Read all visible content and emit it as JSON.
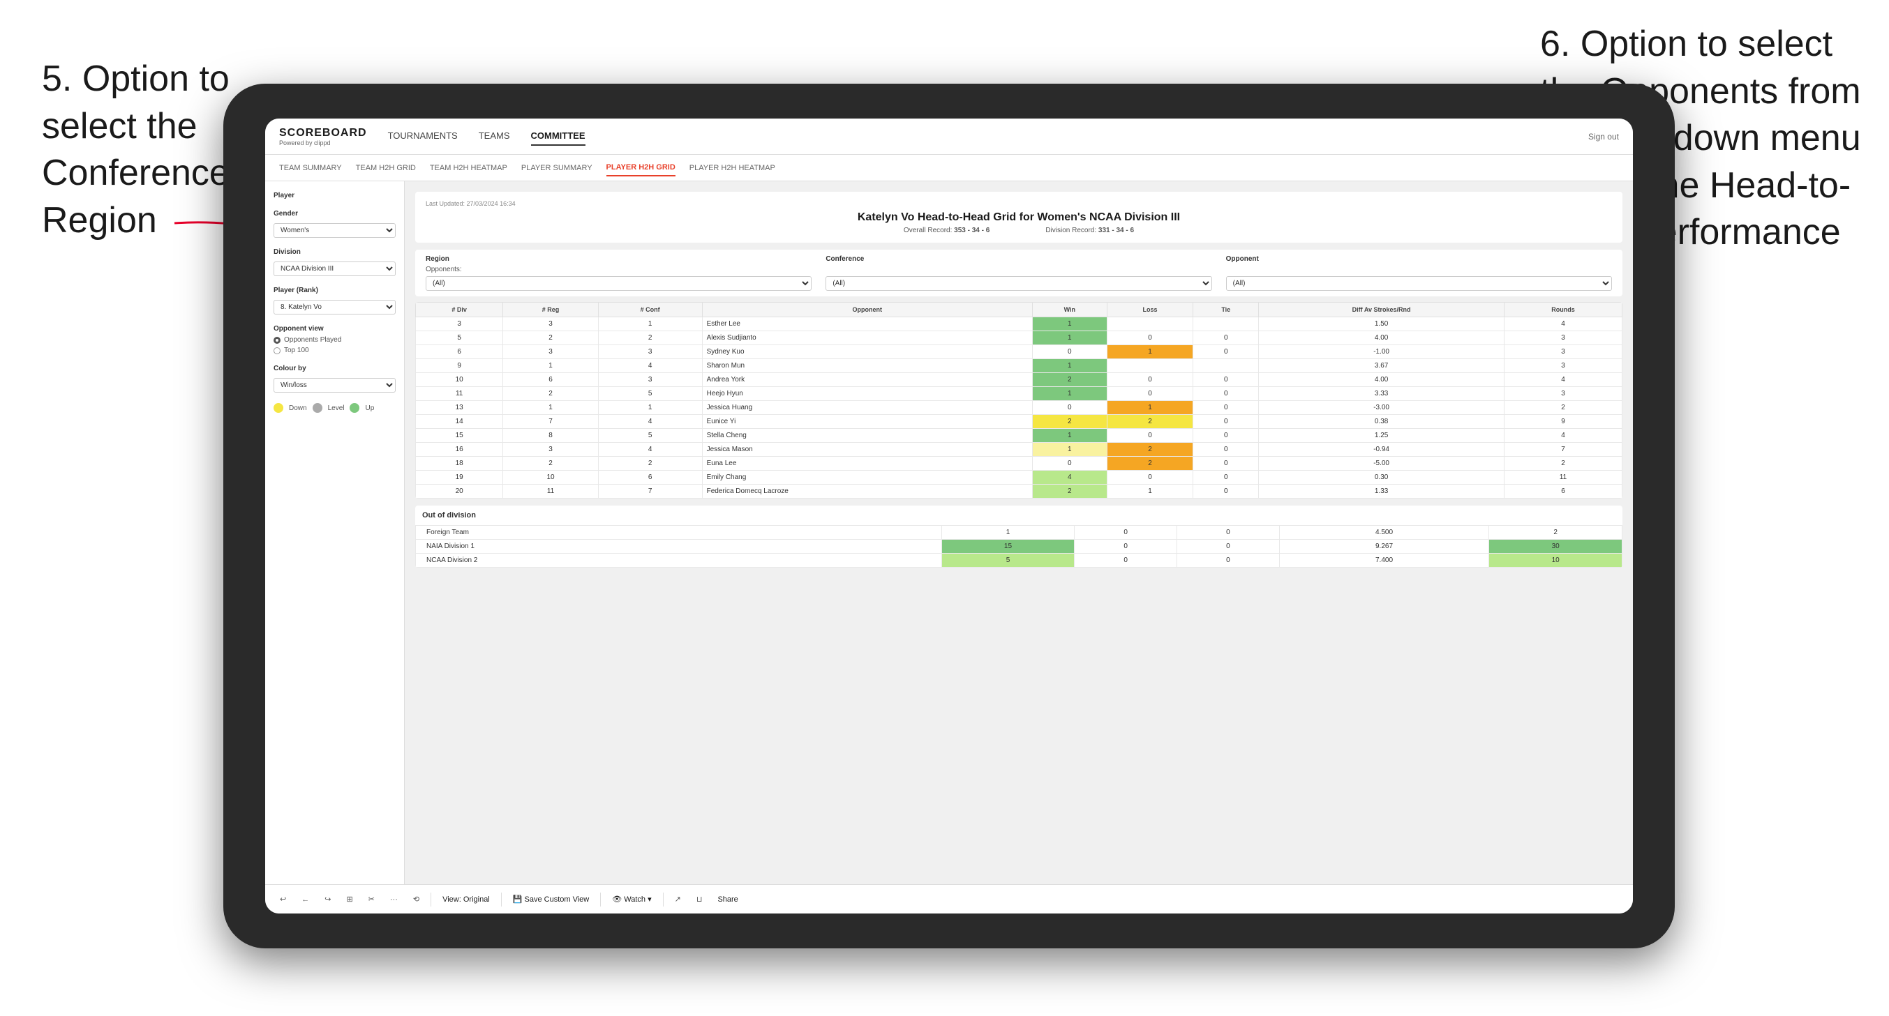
{
  "annotations": {
    "left": {
      "text": "5. Option to select the Conference and Region"
    },
    "right": {
      "text": "6. Option to select the Opponents from the dropdown menu to see the Head-to-Head performance"
    }
  },
  "nav": {
    "logo": "SCOREBOARD",
    "logo_sub": "Powered by clippd",
    "items": [
      "TOURNAMENTS",
      "TEAMS",
      "COMMITTEE"
    ],
    "active": "COMMITTEE",
    "sign_out": "Sign out"
  },
  "sub_nav": {
    "items": [
      "TEAM SUMMARY",
      "TEAM H2H GRID",
      "TEAM H2H HEATMAP",
      "PLAYER SUMMARY",
      "PLAYER H2H GRID",
      "PLAYER H2H HEATMAP"
    ],
    "active": "PLAYER H2H GRID"
  },
  "left_panel": {
    "player_label": "Player",
    "gender_label": "Gender",
    "gender_value": "Women's",
    "division_label": "Division",
    "division_value": "NCAA Division III",
    "player_rank_label": "Player (Rank)",
    "player_rank_value": "8. Katelyn Vo",
    "opponent_view_label": "Opponent view",
    "opponent_view_options": [
      "Opponents Played",
      "Top 100"
    ],
    "opponent_view_selected": "Opponents Played",
    "colour_by_label": "Colour by",
    "colour_by_value": "Win/loss",
    "legend": {
      "down_label": "Down",
      "level_label": "Level",
      "up_label": "Up"
    }
  },
  "content": {
    "last_updated": "Last Updated: 27/03/2024 16:34",
    "title": "Katelyn Vo Head-to-Head Grid for Women's NCAA Division III",
    "overall_record_label": "Overall Record:",
    "overall_record": "353 - 34 - 6",
    "division_record_label": "Division Record:",
    "division_record": "331 - 34 - 6"
  },
  "filters": {
    "region_label": "Region",
    "conference_label": "Conference",
    "opponent_label": "Opponent",
    "opponents_label": "Opponents:",
    "region_value": "(All)",
    "conference_value": "(All)",
    "opponent_value": "(All)"
  },
  "table": {
    "headers": [
      "# Div",
      "# Reg",
      "# Conf",
      "Opponent",
      "Win",
      "Loss",
      "Tie",
      "Diff Av Strokes/Rnd",
      "Rounds"
    ],
    "rows": [
      {
        "div": "3",
        "reg": "3",
        "conf": "1",
        "opponent": "Esther Lee",
        "win": "1",
        "loss": "",
        "tie": "",
        "diff": "1.50",
        "rounds": "4",
        "win_color": "green",
        "loss_color": "",
        "tie_color": ""
      },
      {
        "div": "5",
        "reg": "2",
        "conf": "2",
        "opponent": "Alexis Sudjianto",
        "win": "1",
        "loss": "0",
        "tie": "0",
        "diff": "4.00",
        "rounds": "3",
        "win_color": "green"
      },
      {
        "div": "6",
        "reg": "3",
        "conf": "3",
        "opponent": "Sydney Kuo",
        "win": "0",
        "loss": "1",
        "tie": "0",
        "diff": "-1.00",
        "rounds": "3"
      },
      {
        "div": "9",
        "reg": "1",
        "conf": "4",
        "opponent": "Sharon Mun",
        "win": "1",
        "loss": "",
        "tie": "",
        "diff": "3.67",
        "rounds": "3",
        "win_color": "green"
      },
      {
        "div": "10",
        "reg": "6",
        "conf": "3",
        "opponent": "Andrea York",
        "win": "2",
        "loss": "0",
        "tie": "0",
        "diff": "4.00",
        "rounds": "4",
        "win_color": "green"
      },
      {
        "div": "11",
        "reg": "2",
        "conf": "5",
        "opponent": "Heejo Hyun",
        "win": "1",
        "loss": "0",
        "tie": "0",
        "diff": "3.33",
        "rounds": "3",
        "win_color": "green"
      },
      {
        "div": "13",
        "reg": "1",
        "conf": "1",
        "opponent": "Jessica Huang",
        "win": "0",
        "loss": "1",
        "tie": "0",
        "diff": "-3.00",
        "rounds": "2"
      },
      {
        "div": "14",
        "reg": "7",
        "conf": "4",
        "opponent": "Eunice Yi",
        "win": "2",
        "loss": "2",
        "tie": "0",
        "diff": "0.38",
        "rounds": "9",
        "win_color": "yellow"
      },
      {
        "div": "15",
        "reg": "8",
        "conf": "5",
        "opponent": "Stella Cheng",
        "win": "1",
        "loss": "0",
        "tie": "0",
        "diff": "1.25",
        "rounds": "4",
        "win_color": "green"
      },
      {
        "div": "16",
        "reg": "3",
        "conf": "4",
        "opponent": "Jessica Mason",
        "win": "1",
        "loss": "2",
        "tie": "0",
        "diff": "-0.94",
        "rounds": "7"
      },
      {
        "div": "18",
        "reg": "2",
        "conf": "2",
        "opponent": "Euna Lee",
        "win": "0",
        "loss": "2",
        "tie": "0",
        "diff": "-5.00",
        "rounds": "2"
      },
      {
        "div": "19",
        "reg": "10",
        "conf": "6",
        "opponent": "Emily Chang",
        "win": "4",
        "loss": "0",
        "tie": "0",
        "diff": "0.30",
        "rounds": "11",
        "win_color": "light-green"
      },
      {
        "div": "20",
        "reg": "11",
        "conf": "7",
        "opponent": "Federica Domecq Lacroze",
        "win": "2",
        "loss": "1",
        "tie": "0",
        "diff": "1.33",
        "rounds": "6",
        "win_color": "light-green"
      }
    ]
  },
  "out_of_division": {
    "header": "Out of division",
    "rows": [
      {
        "name": "Foreign Team",
        "win": "1",
        "loss": "0",
        "tie": "0",
        "diff": "4.500",
        "rounds": "2"
      },
      {
        "name": "NAIA Division 1",
        "win": "15",
        "loss": "0",
        "tie": "0",
        "diff": "9.267",
        "rounds": "30"
      },
      {
        "name": "NCAA Division 2",
        "win": "5",
        "loss": "0",
        "tie": "0",
        "diff": "7.400",
        "rounds": "10"
      }
    ]
  },
  "toolbar": {
    "items": [
      "↩",
      "←",
      "↪",
      "⊞",
      "✂",
      "·",
      "⟲",
      "View: Original",
      "Save Custom View",
      "Watch ▾",
      "↗",
      "⊔",
      "Share"
    ]
  }
}
